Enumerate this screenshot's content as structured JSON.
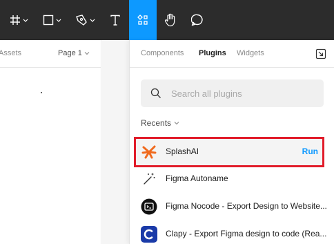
{
  "toolbar": {
    "tools": [
      {
        "name": "frame-tool",
        "icon": "hash-frame-icon",
        "has_menu": true
      },
      {
        "name": "shape-tool",
        "icon": "rectangle-icon",
        "has_menu": true
      },
      {
        "name": "pen-tool",
        "icon": "pen-icon",
        "has_menu": true
      },
      {
        "name": "text-tool",
        "icon": "text-icon",
        "has_menu": false
      },
      {
        "name": "resources-tool",
        "icon": "resources-icon",
        "active": true
      },
      {
        "name": "hand-tool",
        "icon": "hand-icon"
      },
      {
        "name": "comment-tool",
        "icon": "comment-icon"
      }
    ],
    "active_color": "#0d99ff",
    "background": "#2c2c2c"
  },
  "left_panel": {
    "assets_label": "Assets",
    "page_label": "Page 1"
  },
  "popover": {
    "tabs": [
      {
        "label": "Components",
        "active": false
      },
      {
        "label": "Plugins",
        "active": true
      },
      {
        "label": "Widgets",
        "active": false
      }
    ],
    "search": {
      "placeholder": "Search all plugins",
      "value": ""
    },
    "recents_label": "Recents",
    "plugins": [
      {
        "name": "SplashAI",
        "icon": "splash-icon",
        "action": "Run",
        "highlighted": true
      },
      {
        "name": "Figma Autoname",
        "icon": "magic-wand-icon"
      },
      {
        "name": "Figma Nocode - Export Design to Website...",
        "icon": "nocode-icon"
      },
      {
        "name": "Clapy - Export Figma design to code (Rea...",
        "icon": "clapy-icon"
      }
    ]
  },
  "colors": {
    "accent": "#0d99ff",
    "highlight_border": "#e11c2a",
    "splash_orange": "#f06a1d"
  }
}
